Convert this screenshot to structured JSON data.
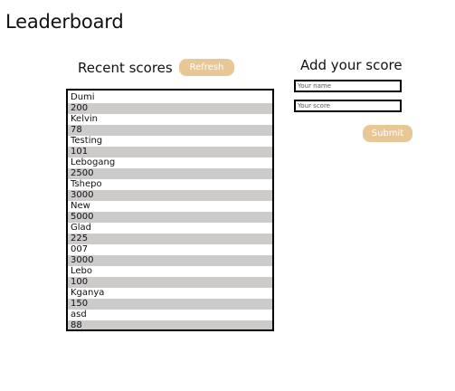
{
  "page": {
    "title": "Leaderboard"
  },
  "recent": {
    "title": "Recent scores",
    "refresh_label": "Refresh",
    "entries": [
      {
        "name": "Dumi",
        "score": "200"
      },
      {
        "name": "Kelvin",
        "score": "78"
      },
      {
        "name": "Testing",
        "score": "101"
      },
      {
        "name": "Lebogang",
        "score": "2500"
      },
      {
        "name": "Tshepo",
        "score": "3000"
      },
      {
        "name": "New",
        "score": "5000"
      },
      {
        "name": "Glad",
        "score": "225"
      },
      {
        "name": "007",
        "score": "3000"
      },
      {
        "name": "Lebo",
        "score": "100"
      },
      {
        "name": "Kganya",
        "score": "150"
      },
      {
        "name": "asd",
        "score": "88"
      }
    ]
  },
  "add": {
    "title": "Add your score",
    "name_placeholder": "Your name",
    "score_placeholder": "Your score",
    "submit_label": "Submit"
  },
  "colors": {
    "accent": "#e8c696",
    "row_stripe": "#cdcaca",
    "border": "#000000"
  }
}
